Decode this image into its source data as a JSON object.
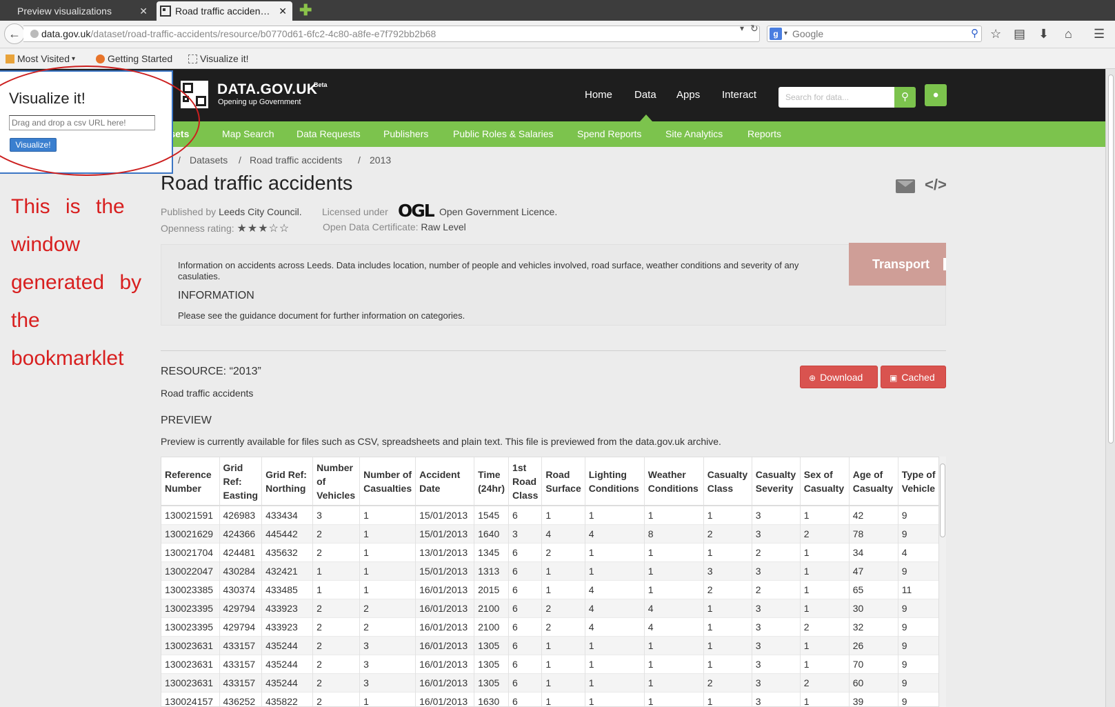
{
  "browser": {
    "tabs": [
      {
        "label": "Preview visualizations",
        "active": false
      },
      {
        "label": "Road traffic acciden…",
        "active": true
      }
    ],
    "url_host": "data.gov.uk",
    "url_path": "/dataset/road-traffic-accidents/resource/b0770d61-6fc2-4c80-a8fe-e7f792bb2b68",
    "search_placeholder": "Google",
    "bookmarks": [
      "Most Visited",
      "Getting Started",
      "Visualize it!"
    ]
  },
  "site": {
    "logo_title": "DATA.GOV.UK",
    "logo_beta": "Beta",
    "logo_subtitle": "Opening up Government",
    "main_nav": [
      "Home",
      "Data",
      "Apps",
      "Interact"
    ],
    "search_placeholder": "Search for data...",
    "subnav": [
      "Datasets",
      "Map Search",
      "Data Requests",
      "Publishers",
      "Public Roles & Salaries",
      "Spend Reports",
      "Site Analytics",
      "Reports"
    ],
    "accent_color": "#7cc34d"
  },
  "breadcrumb": [
    "Datasets",
    "Road traffic accidents",
    "2013"
  ],
  "dataset": {
    "title": "Road traffic accidents",
    "published_by_label": "Published by",
    "publisher": "Leeds City Council.",
    "licensed_label": "Licensed under",
    "licence_logo": "OGL",
    "licence": "Open Government Licence.",
    "openness_label": "Openness rating:",
    "openness_stars": "★★★☆☆",
    "certificate_label": "Open Data Certificate:",
    "certificate": "Raw Level",
    "description": "Information on accidents across Leeds. Data includes location, number of people and vehicles involved, road surface, weather conditions and severity of any casulaties.",
    "info_heading": "INFORMATION",
    "info_text": "Please see the guidance document for further information on categories.",
    "tag": "Transport"
  },
  "resource": {
    "heading": "RESOURCE: “2013”",
    "subtitle": "Road traffic accidents",
    "download_label": "Download",
    "cached_label": "Cached",
    "button_color": "#d9534f"
  },
  "preview": {
    "heading": "PREVIEW",
    "text": "Preview is currently available for files such as CSV, spreadsheets and plain text. This file is previewed from the data.gov.uk archive.",
    "columns": [
      "Reference Number",
      "Grid Ref: Easting",
      "Grid Ref: Northing",
      "Number of Vehicles",
      "Number of Casualties",
      "Accident Date",
      "Time (24hr)",
      "1st Road Class",
      "Road Surface",
      "Lighting Conditions",
      "Weather Conditions",
      "Casualty Class",
      "Casualty Severity",
      "Sex of Casualty",
      "Age of Casualty",
      "Type of Vehicle"
    ],
    "rows": [
      [
        "130021591",
        "426983",
        "433434",
        "3",
        "1",
        "15/01/2013",
        "1545",
        "6",
        "1",
        "1",
        "1",
        "1",
        "3",
        "1",
        "42",
        "9"
      ],
      [
        "130021629",
        "424366",
        "445442",
        "2",
        "1",
        "15/01/2013",
        "1640",
        "3",
        "4",
        "4",
        "8",
        "2",
        "3",
        "2",
        "78",
        "9"
      ],
      [
        "130021704",
        "424481",
        "435632",
        "2",
        "1",
        "13/01/2013",
        "1345",
        "6",
        "2",
        "1",
        "1",
        "1",
        "2",
        "1",
        "34",
        "4"
      ],
      [
        "130022047",
        "430284",
        "432421",
        "1",
        "1",
        "15/01/2013",
        "1313",
        "6",
        "1",
        "1",
        "1",
        "3",
        "3",
        "1",
        "47",
        "9"
      ],
      [
        "130023385",
        "430374",
        "433485",
        "1",
        "1",
        "16/01/2013",
        "2015",
        "6",
        "1",
        "4",
        "1",
        "2",
        "2",
        "1",
        "65",
        "11"
      ],
      [
        "130023395",
        "429794",
        "433923",
        "2",
        "2",
        "16/01/2013",
        "2100",
        "6",
        "2",
        "4",
        "4",
        "1",
        "3",
        "1",
        "30",
        "9"
      ],
      [
        "130023395",
        "429794",
        "433923",
        "2",
        "2",
        "16/01/2013",
        "2100",
        "6",
        "2",
        "4",
        "4",
        "1",
        "3",
        "2",
        "32",
        "9"
      ],
      [
        "130023631",
        "433157",
        "435244",
        "2",
        "3",
        "16/01/2013",
        "1305",
        "6",
        "1",
        "1",
        "1",
        "1",
        "3",
        "1",
        "26",
        "9"
      ],
      [
        "130023631",
        "433157",
        "435244",
        "2",
        "3",
        "16/01/2013",
        "1305",
        "6",
        "1",
        "1",
        "1",
        "1",
        "3",
        "1",
        "70",
        "9"
      ],
      [
        "130023631",
        "433157",
        "435244",
        "2",
        "3",
        "16/01/2013",
        "1305",
        "6",
        "1",
        "1",
        "1",
        "2",
        "3",
        "2",
        "60",
        "9"
      ],
      [
        "130024157",
        "436252",
        "435822",
        "2",
        "1",
        "16/01/2013",
        "1630",
        "6",
        "1",
        "1",
        "1",
        "1",
        "3",
        "1",
        "39",
        "9"
      ]
    ]
  },
  "bookmarklet": {
    "title": "Visualize it!",
    "input_placeholder": "Drag and drop a csv URL here!",
    "button_label": "Visualize!",
    "annotation": "This is the window generated by the bookmarklet",
    "annotation_color": "#d81f1f"
  }
}
